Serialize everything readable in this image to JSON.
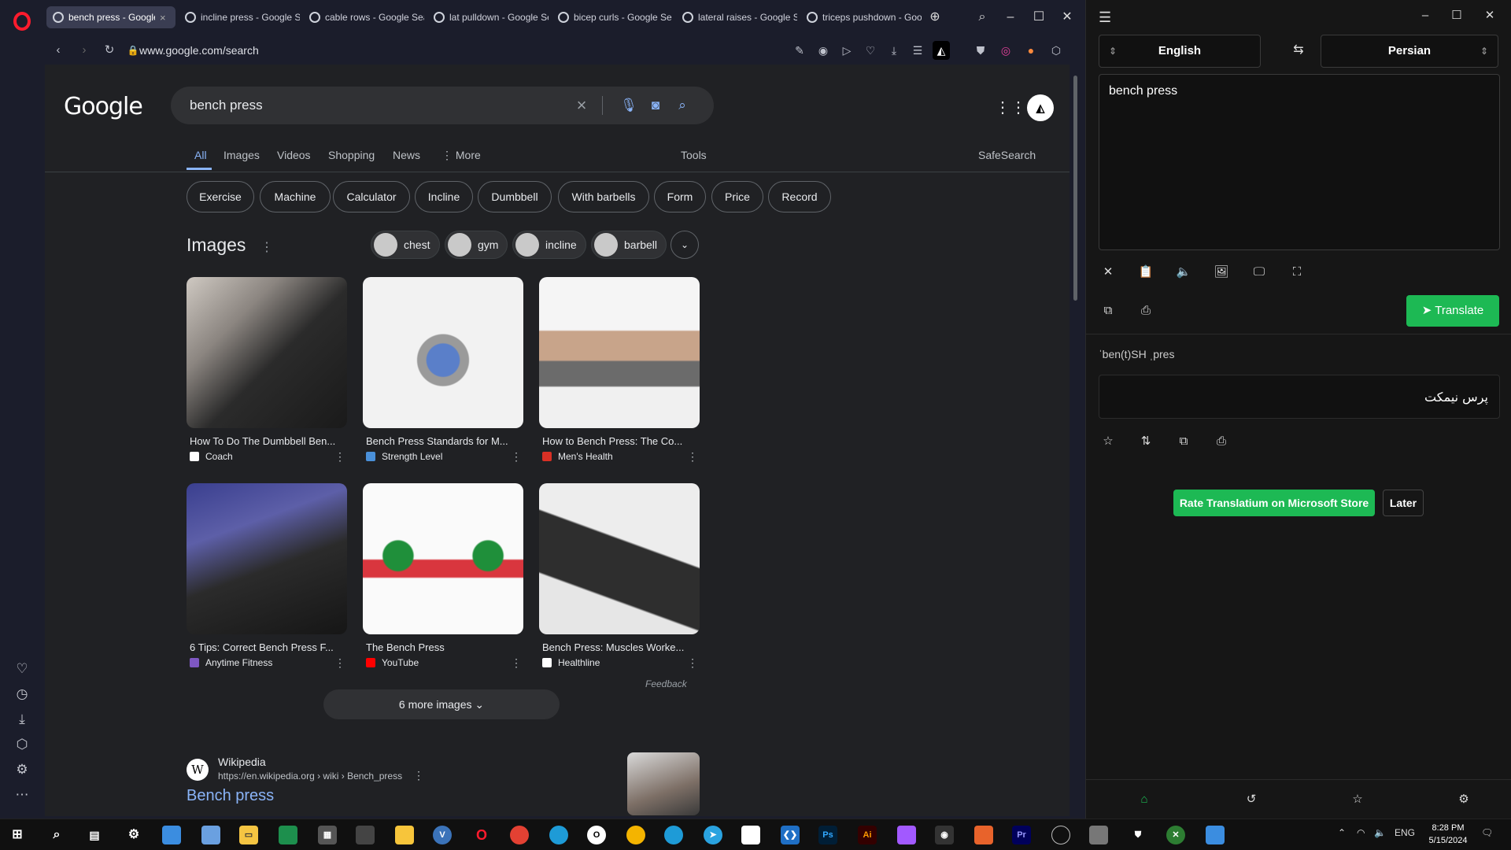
{
  "browser": {
    "tabs": [
      {
        "title": "bench press - Google Sear",
        "active": true
      },
      {
        "title": "incline press - Google Se"
      },
      {
        "title": "cable rows - Google Sea"
      },
      {
        "title": "lat pulldown - Google Se"
      },
      {
        "title": "bicep curls - Google Se"
      },
      {
        "title": "lateral raises - Google S"
      },
      {
        "title": "triceps pushdown - Goo"
      }
    ],
    "url": "www.google.com/search"
  },
  "google": {
    "logo": "Google",
    "query": "bench press",
    "tabs": [
      "All",
      "Images",
      "Videos",
      "Shopping",
      "News",
      "More"
    ],
    "tools": "Tools",
    "safesearch": "SafeSearch",
    "chips": [
      "Exercise",
      "Machine",
      "Calculator",
      "Incline",
      "Dumbbell",
      "With barbells",
      "Form",
      "Price",
      "Record"
    ],
    "images_title": "Images",
    "image_chips": [
      "chest",
      "gym",
      "incline",
      "barbell"
    ],
    "results": [
      {
        "title": "How To Do The Dumbbell Ben...",
        "source": "Coach",
        "color": "#ffffff"
      },
      {
        "title": "Bench Press Standards for M...",
        "source": "Strength Level",
        "color": "#4a90d9"
      },
      {
        "title": "How to Bench Press: The Co...",
        "source": "Men's Health",
        "color": "#d93025"
      },
      {
        "title": "6 Tips: Correct Bench Press F...",
        "source": "Anytime Fitness",
        "color": "#7e57c2"
      },
      {
        "title": "The Bench Press",
        "source": "YouTube",
        "color": "#ff0000"
      },
      {
        "title": "Bench Press: Muscles Worke...",
        "source": "Healthline",
        "color": "#ffffff"
      }
    ],
    "feedback": "Feedback",
    "more_images": "6 more images",
    "wiki": {
      "name": "Wikipedia",
      "url": "https://en.wikipedia.org › wiki › Bench_press",
      "title": "Bench press"
    }
  },
  "translator": {
    "source_lang": "English",
    "target_lang": "Persian",
    "input": "bench press",
    "translate_label": "Translate",
    "phonetic": "ˈben(t)SH ˌpres",
    "output": "پرس نیمکت",
    "rate_label": "Rate Translatium on Microsoft Store",
    "later_label": "Later",
    "accent": "#1db954"
  },
  "taskbar": {
    "lang": "ENG",
    "time": "8:28 PM",
    "date": "5/15/2024"
  }
}
